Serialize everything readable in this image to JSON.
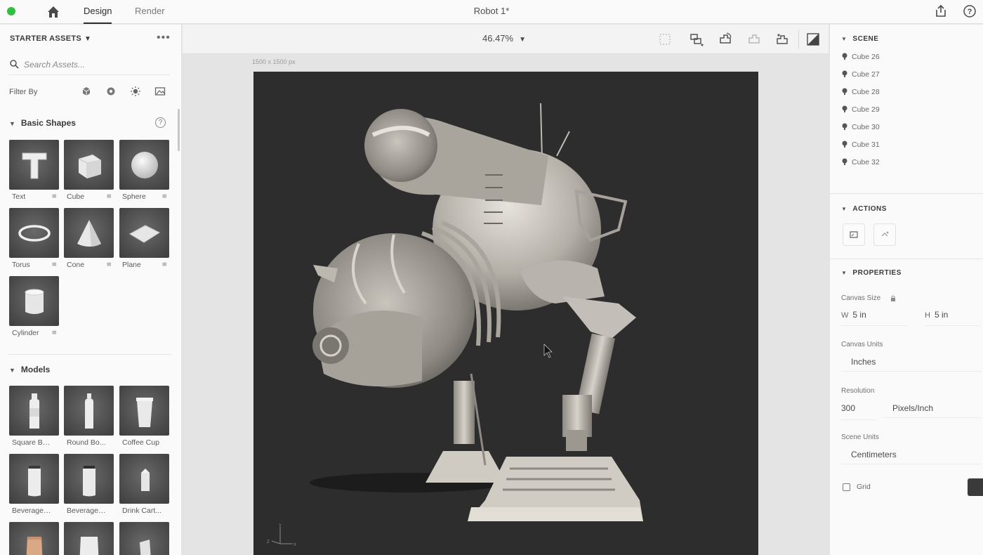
{
  "topbar": {
    "tabs": [
      {
        "label": "Design",
        "active": true
      },
      {
        "label": "Render",
        "active": false
      }
    ],
    "document_title": "Robot 1*",
    "icons": [
      "home-icon",
      "share-icon",
      "help-icon"
    ]
  },
  "left_panel": {
    "header": "STARTER ASSETS",
    "search_placeholder": "Search Assets...",
    "filter_label": "Filter By",
    "filter_icons": [
      "model-filter-icon",
      "material-filter-icon",
      "light-filter-icon",
      "image-filter-icon"
    ],
    "basic_shapes": {
      "title": "Basic Shapes",
      "help": "?",
      "items": [
        {
          "label": "Text"
        },
        {
          "label": "Cube"
        },
        {
          "label": "Sphere"
        },
        {
          "label": "Torus"
        },
        {
          "label": "Cone"
        },
        {
          "label": "Plane"
        },
        {
          "label": "Cylinder"
        }
      ]
    },
    "models": {
      "title": "Models",
      "items": [
        {
          "label": "Square Bo..."
        },
        {
          "label": "Round Bo..."
        },
        {
          "label": "Coffee Cup"
        },
        {
          "label": "Beverage ..."
        },
        {
          "label": "Beverage ..."
        },
        {
          "label": "Drink Cart..."
        }
      ]
    }
  },
  "canvas_toolbar": {
    "zoom": "46.47%",
    "canvas_size_label": "1500 x 1500 px"
  },
  "right_panel": {
    "scene": {
      "title": "SCENE",
      "items": [
        "Cube 26",
        "Cube 27",
        "Cube 28",
        "Cube 29",
        "Cube 30",
        "Cube 31",
        "Cube 32"
      ]
    },
    "actions": {
      "title": "ACTIONS"
    },
    "properties": {
      "title": "PROPERTIES",
      "canvas_size_label": "Canvas Size",
      "width_prefix": "W",
      "width_value": "5 in",
      "height_prefix": "H",
      "height_value": "5 in",
      "canvas_units_label": "Canvas Units",
      "canvas_units_value": "Inches",
      "resolution_label": "Resolution",
      "resolution_value": "300",
      "resolution_unit": "Pixels/Inch",
      "scene_units_label": "Scene Units",
      "scene_units_value": "Centimeters",
      "grid_label": "Grid",
      "grid_checked": false
    }
  },
  "colors": {
    "accent_green": "#2ec13e",
    "canvas_bg": "#2d2d2d",
    "panel_bg": "#fafafa",
    "workspace_bg": "#e4e4e4"
  }
}
